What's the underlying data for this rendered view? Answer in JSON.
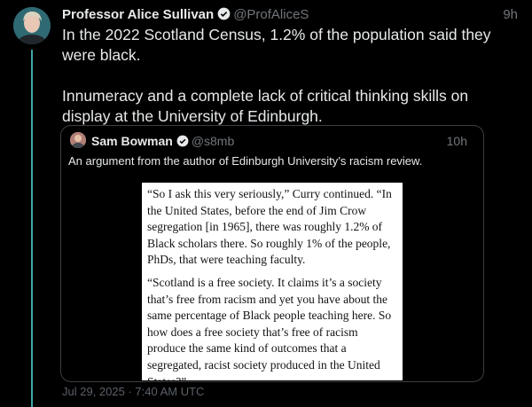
{
  "tweet": {
    "author_name": "Professor Alice Sullivan",
    "handle": "@ProfAliceS",
    "time": "9h",
    "text_paragraphs": [
      "In the 2022 Scotland Census, 1.2% of the population said they were black.",
      "Innumeracy and a complete lack of critical thinking skills on display at the University of Edinburgh."
    ],
    "timestamp": "Jul 29, 2025 · 7:40 AM UTC"
  },
  "quote": {
    "author_name": "Sam Bowman",
    "handle": "@s8mb",
    "time": "10h",
    "text": "An argument from the author of Edinburgh University’s racism review.",
    "image_paragraphs": [
      "“So I ask this very seriously,” Curry continued. “In the United States, before the end of Jim Crow segregation [in 1965], there was roughly 1.2% of Black scholars there. So roughly 1% of the people, PhDs, that were teaching faculty.",
      "“Scotland is a free society. It claims it’s a society that’s free from racism and yet you have about the same percentage of Black people teaching here. So how does a free society that’s free of racism produce the same kind of outcomes that a segregated, racist society produced in the United States?”"
    ]
  },
  "colors": {
    "background": "#000000",
    "thread_line": "#40a6a9",
    "muted_text": "#71767b"
  },
  "icons": {
    "verified": "verified-badge-icon"
  }
}
